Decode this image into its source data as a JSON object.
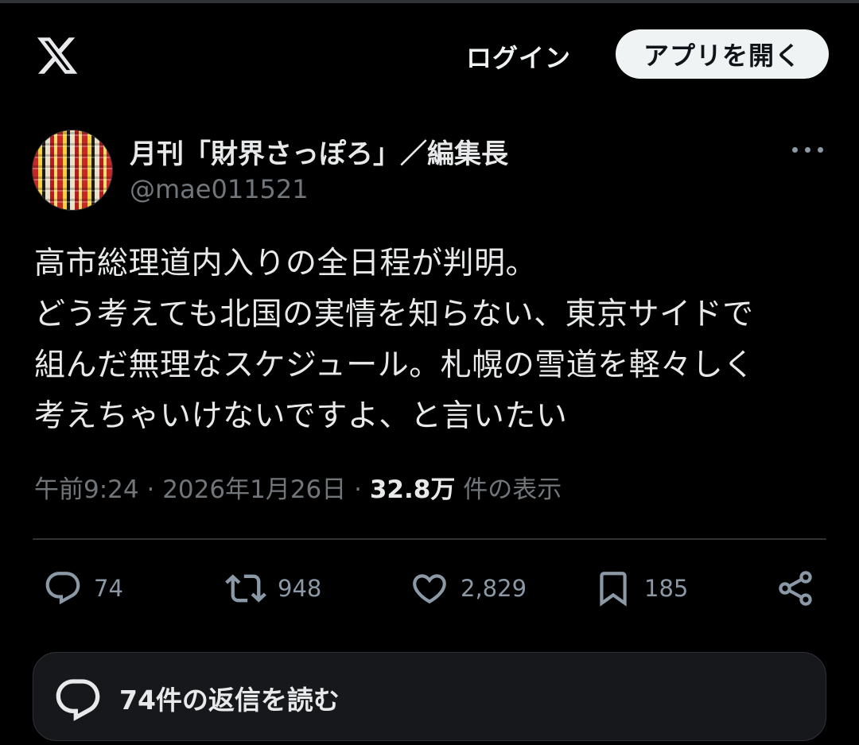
{
  "header": {
    "logo_icon": "x-logo-icon",
    "login_label": "ログイン",
    "open_app_label": "アプリを開く"
  },
  "author": {
    "display_name": "月刊「財界さっぽろ」／編集長",
    "handle": "@mae011521"
  },
  "tweet": {
    "text": "高市総理道内入りの全日程が判明。\nどう考えても北国の実情を知らない、東京サイドで\n組んだ無理なスケジュール。札幌の雪道を軽々しく\n考えちゃいけないですよ、と言いたい",
    "time": "午前9:24",
    "separator": "·",
    "date": "2026年1月26日",
    "views_count": "32.8万",
    "views_suffix": "件の表示"
  },
  "actions": {
    "replies": "74",
    "retweets": "948",
    "likes": "2,829",
    "bookmarks": "185"
  },
  "reply_box": {
    "label": "74件の返信を読む"
  },
  "colors": {
    "background": "#000000",
    "text_primary": "#e7e9ea",
    "text_secondary": "#71767b",
    "button_bg": "#eff3f4"
  }
}
